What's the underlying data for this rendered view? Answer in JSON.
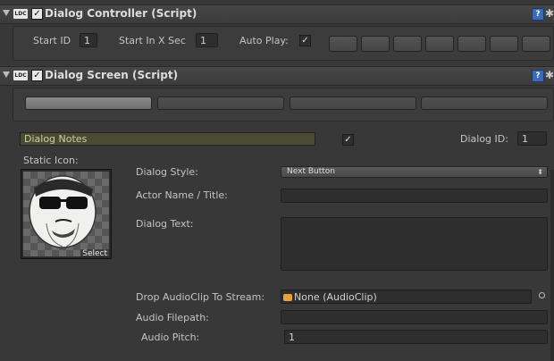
{
  "dialog_controller": {
    "script_badge": "LDC",
    "enabled_mark": "✓",
    "title": "Dialog Controller (Script)",
    "start_id_label": "Start ID",
    "start_id_value": "1",
    "start_in_label": "Start In X Sec",
    "start_in_value": "1",
    "auto_play_label": "Auto Play:",
    "auto_play_mark": "✓",
    "help_icon": "help-icon",
    "settings_icon": "gear-icon"
  },
  "dialog_screen": {
    "script_badge": "LDC",
    "enabled_mark": "✓",
    "title": "Dialog Screen (Script)",
    "help_icon": "help-icon",
    "settings_icon": "gear-icon",
    "notes_value": "Dialog Notes",
    "notes_checkbox_mark": "✓",
    "dialog_id_label": "Dialog ID:",
    "dialog_id_value": "1",
    "static_icon_label": "Static Icon:",
    "select_label": "Select",
    "dialog_style_label": "Dialog Style:",
    "dialog_style_value": "Next Button",
    "dropdown_arrow": "⬍",
    "actor_name_label": "Actor Name / Title:",
    "actor_name_value": "",
    "dialog_text_label": "Dialog Text:",
    "dialog_text_value": "",
    "audio_clip_label": "Drop AudioClip To Stream:",
    "audio_clip_value": "None (AudioClip)",
    "audio_filepath_label": "Audio Filepath:",
    "audio_filepath_value": "",
    "audio_pitch_label": "Audio Pitch:",
    "audio_pitch_value": "1"
  }
}
